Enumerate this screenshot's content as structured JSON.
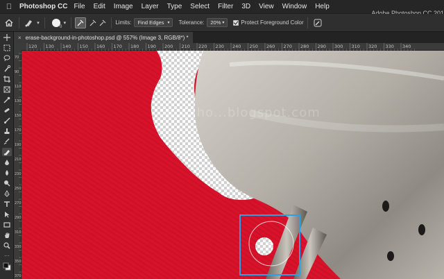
{
  "menubar": {
    "app_name": "Photoshop CC",
    "items": [
      "File",
      "Edit",
      "Image",
      "Layer",
      "Type",
      "Select",
      "Filter",
      "3D",
      "View",
      "Window",
      "Help"
    ]
  },
  "window_title": "Adobe Photoshop CC 201",
  "options_bar": {
    "brush_size": "0",
    "limits_label": "Limits:",
    "limits_value": "Find Edges",
    "tolerance_label": "Tolerance:",
    "tolerance_value": "20%",
    "protect_label": "Protect Foreground Color",
    "protect_checked": true
  },
  "document_tab": {
    "close": "×",
    "title": "erase-background-in-photoshop.psd @ 557% (Image 3, RGB/8*) *"
  },
  "ruler": {
    "h_ticks": [
      "120",
      "130",
      "140",
      "150",
      "160",
      "170",
      "180",
      "190",
      "200",
      "210",
      "220",
      "230",
      "240",
      "250",
      "260",
      "270",
      "280",
      "290",
      "300",
      "310",
      "320",
      "330",
      "340"
    ],
    "v_ticks": [
      "70",
      "80",
      "90",
      "100",
      "110",
      "120",
      "130",
      "140",
      "150",
      "160",
      "170",
      "180",
      "190",
      "200",
      "210",
      "220",
      "230",
      "240",
      "250",
      "260",
      "270",
      "280",
      "290",
      "300",
      "310",
      "320",
      "330",
      "340",
      "350",
      "360",
      "370",
      "380"
    ]
  },
  "watermark": "entaho...blogspot.com",
  "tools": [
    "move-tool",
    "marquee-tool",
    "lasso-tool",
    "quick-selection-tool",
    "crop-tool",
    "eyedropper-tool",
    "healing-brush-tool",
    "brush-tool",
    "clone-stamp-tool",
    "history-brush-tool",
    "background-eraser-tool",
    "gradient-tool",
    "blur-tool",
    "dodge-tool",
    "pen-tool",
    "type-tool",
    "path-selection-tool",
    "rectangle-tool",
    "hand-tool",
    "zoom-tool"
  ],
  "colors": {
    "canvas_red": "#d8122a",
    "accent": "#2aa1e6",
    "metal": "#b9b4ac"
  }
}
